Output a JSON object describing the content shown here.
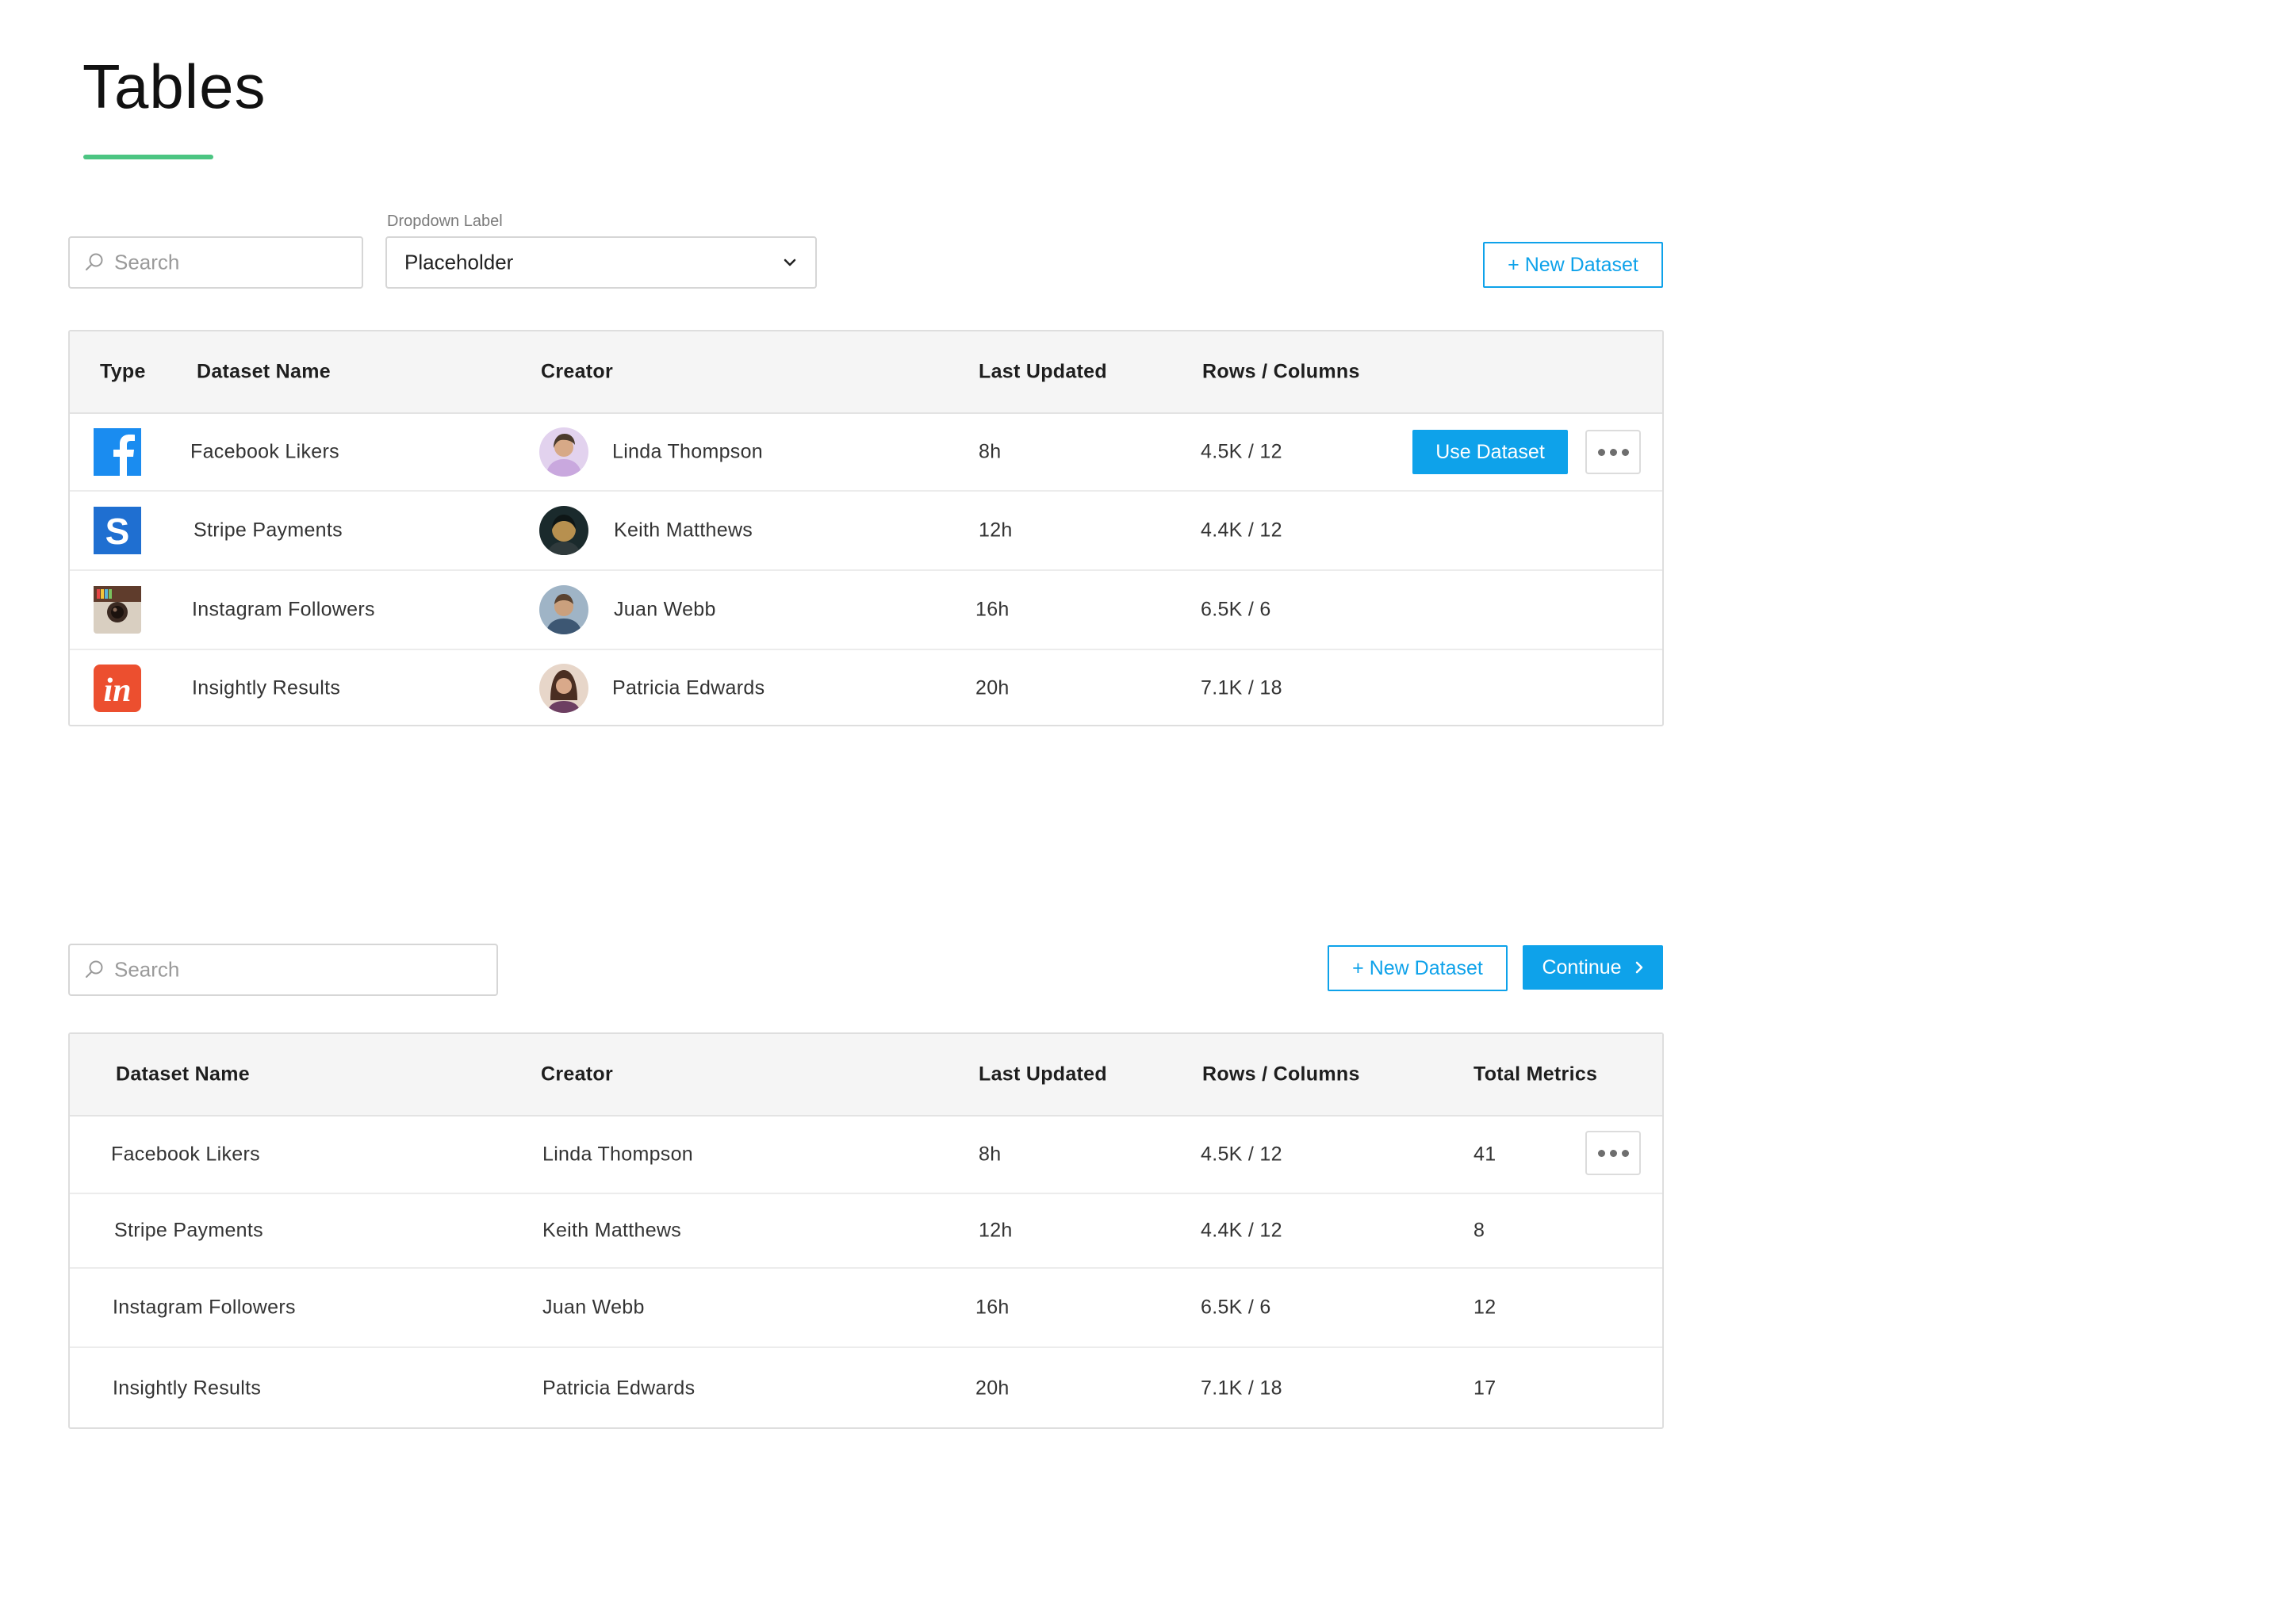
{
  "page": {
    "title": "Tables"
  },
  "colors": {
    "accent": "#0ea2ea",
    "underline": "#4cc582",
    "facebook": "#1a8cf0",
    "stripe": "#1f6fd1",
    "invision": "#ec4f2f"
  },
  "toolbar1": {
    "search_placeholder": "Search",
    "dropdown_label": "Dropdown Label",
    "dropdown_value": "Placeholder",
    "new_dataset_label": "+ New Dataset"
  },
  "table1": {
    "headers": {
      "type": "Type",
      "name": "Dataset Name",
      "creator": "Creator",
      "updated": "Last Updated",
      "rows_cols": "Rows / Columns"
    },
    "use_dataset_label": "Use Dataset",
    "rows": [
      {
        "type_icon": "facebook-icon",
        "name": "Facebook Likers",
        "creator": "Linda Thompson",
        "updated": "8h",
        "rows_cols": "4.5K / 12"
      },
      {
        "type_icon": "stripe-icon",
        "name": "Stripe Payments",
        "creator": "Keith Matthews",
        "updated": "12h",
        "rows_cols": "4.4K / 12"
      },
      {
        "type_icon": "instagram-icon",
        "name": "Instagram Followers",
        "creator": "Juan Webb",
        "updated": "16h",
        "rows_cols": "6.5K / 6"
      },
      {
        "type_icon": "invision-icon",
        "name": "Insightly Results",
        "creator": "Patricia Edwards",
        "updated": "20h",
        "rows_cols": "7.1K / 18"
      }
    ]
  },
  "toolbar2": {
    "search_placeholder": "Search",
    "new_dataset_label": "+ New Dataset",
    "continue_label": "Continue"
  },
  "table2": {
    "headers": {
      "name": "Dataset Name",
      "creator": "Creator",
      "updated": "Last Updated",
      "rows_cols": "Rows / Columns",
      "metrics": "Total Metrics"
    },
    "rows": [
      {
        "name": "Facebook Likers",
        "creator": "Linda Thompson",
        "updated": "8h",
        "rows_cols": "4.5K / 12",
        "metrics": "41"
      },
      {
        "name": "Stripe Payments",
        "creator": "Keith Matthews",
        "updated": "12h",
        "rows_cols": "4.4K / 12",
        "metrics": "8"
      },
      {
        "name": "Instagram Followers",
        "creator": "Juan Webb",
        "updated": "16h",
        "rows_cols": "6.5K / 6",
        "metrics": "12"
      },
      {
        "name": "Insightly Results",
        "creator": "Patricia Edwards",
        "updated": "20h",
        "rows_cols": "7.1K / 18",
        "metrics": "17"
      }
    ]
  }
}
